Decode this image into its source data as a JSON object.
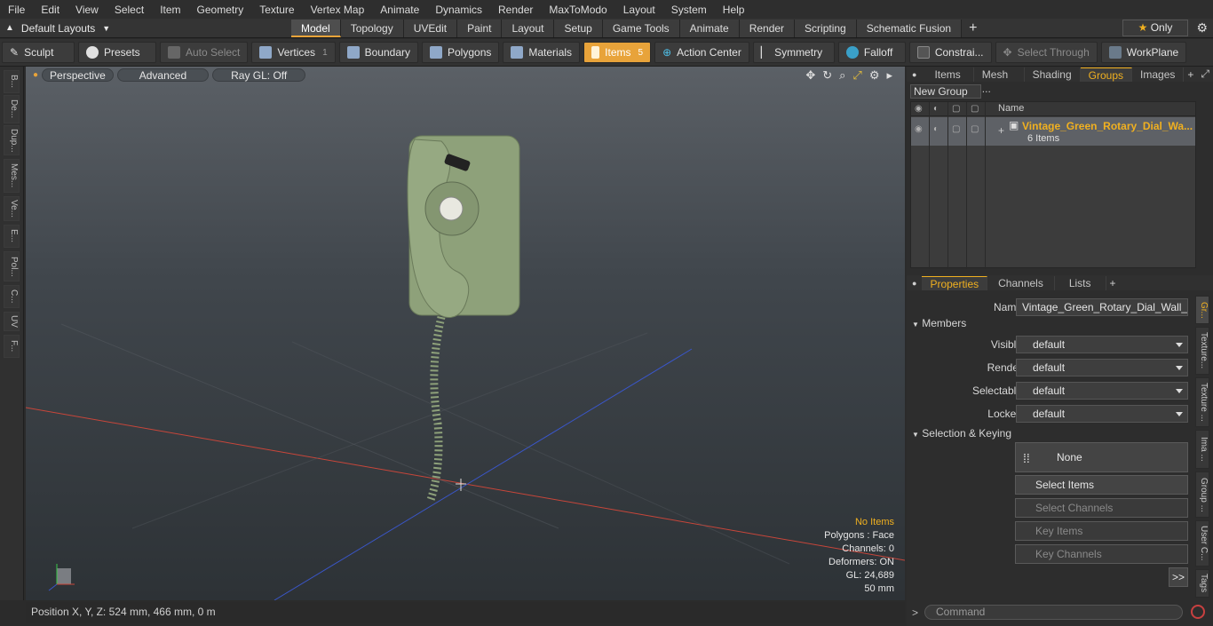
{
  "menu": [
    "File",
    "Edit",
    "View",
    "Select",
    "Item",
    "Geometry",
    "Texture",
    "Vertex Map",
    "Animate",
    "Dynamics",
    "Render",
    "MaxToModo",
    "Layout",
    "System",
    "Help"
  ],
  "layouts_label": "Default Layouts",
  "layout_tabs": [
    "Model",
    "Topology",
    "UVEdit",
    "Paint",
    "Layout",
    "Setup",
    "Game Tools",
    "Animate",
    "Render",
    "Scripting",
    "Schematic Fusion"
  ],
  "only_label": "Only",
  "toolbar": {
    "sculpt": "Sculpt",
    "presets": "Presets",
    "auto_select": "Auto Select",
    "vertices": "Vertices",
    "vertices_count": "1",
    "boundary": "Boundary",
    "polygons": "Polygons",
    "materials": "Materials",
    "items": "Items",
    "items_count": "5",
    "action_center": "Action Center",
    "symmetry": "Symmetry",
    "falloff": "Falloff",
    "constraints": "Constrai...",
    "select_through": "Select Through",
    "workplane": "WorkPlane"
  },
  "left_tabs": [
    "B...",
    "De...",
    "Dup...",
    "Mes...",
    "Ve...",
    "E...",
    "Pol...",
    "C...",
    "UV",
    "F..."
  ],
  "viewport": {
    "perspective": "Perspective",
    "advanced": "Advanced",
    "raygl": "Ray GL: Off",
    "stats": {
      "selection": "No Items",
      "polygons": "Polygons : Face",
      "channels": "Channels: 0",
      "deformers": "Deformers: ON",
      "gl": "GL: 24,689",
      "scale": "50 mm"
    }
  },
  "status_position": "Position X, Y, Z:   524 mm, 466 mm, 0 m",
  "top_panel_tabs": [
    "Items",
    "Mesh ...",
    "Shading",
    "Groups",
    "Images"
  ],
  "new_group_label": "New Group",
  "group_header_name": "Name",
  "group": {
    "name": "Vintage_Green_Rotary_Dial_Wa...",
    "count": "6 Items"
  },
  "props_tabs": [
    "Properties",
    "Channels",
    "Lists"
  ],
  "props": {
    "name_label": "Name",
    "name_value": "Vintage_Green_Rotary_Dial_Wall_Phc",
    "members_section": "Members",
    "visible_label": "Visible",
    "visible_value": "default",
    "render_label": "Render",
    "render_value": "default",
    "selectable_label": "Selectable",
    "selectable_value": "default",
    "locked_label": "Locked",
    "locked_value": "default",
    "sel_section": "Selection & Keying",
    "none_label": "None",
    "select_items": "Select Items",
    "select_channels": "Select Channels",
    "key_items": "Key Items",
    "key_channels": "Key Channels",
    "more": ">>"
  },
  "right_vtabs": [
    "Gr...",
    "Texture...",
    "Texture ...",
    "Ima ...",
    "Group ...",
    "User C...",
    "Tags"
  ],
  "command_placeholder": "Command",
  "colors": {
    "accent": "#f0b020",
    "items_active": "#e8a33a",
    "phone_green": "#8ea17a"
  }
}
